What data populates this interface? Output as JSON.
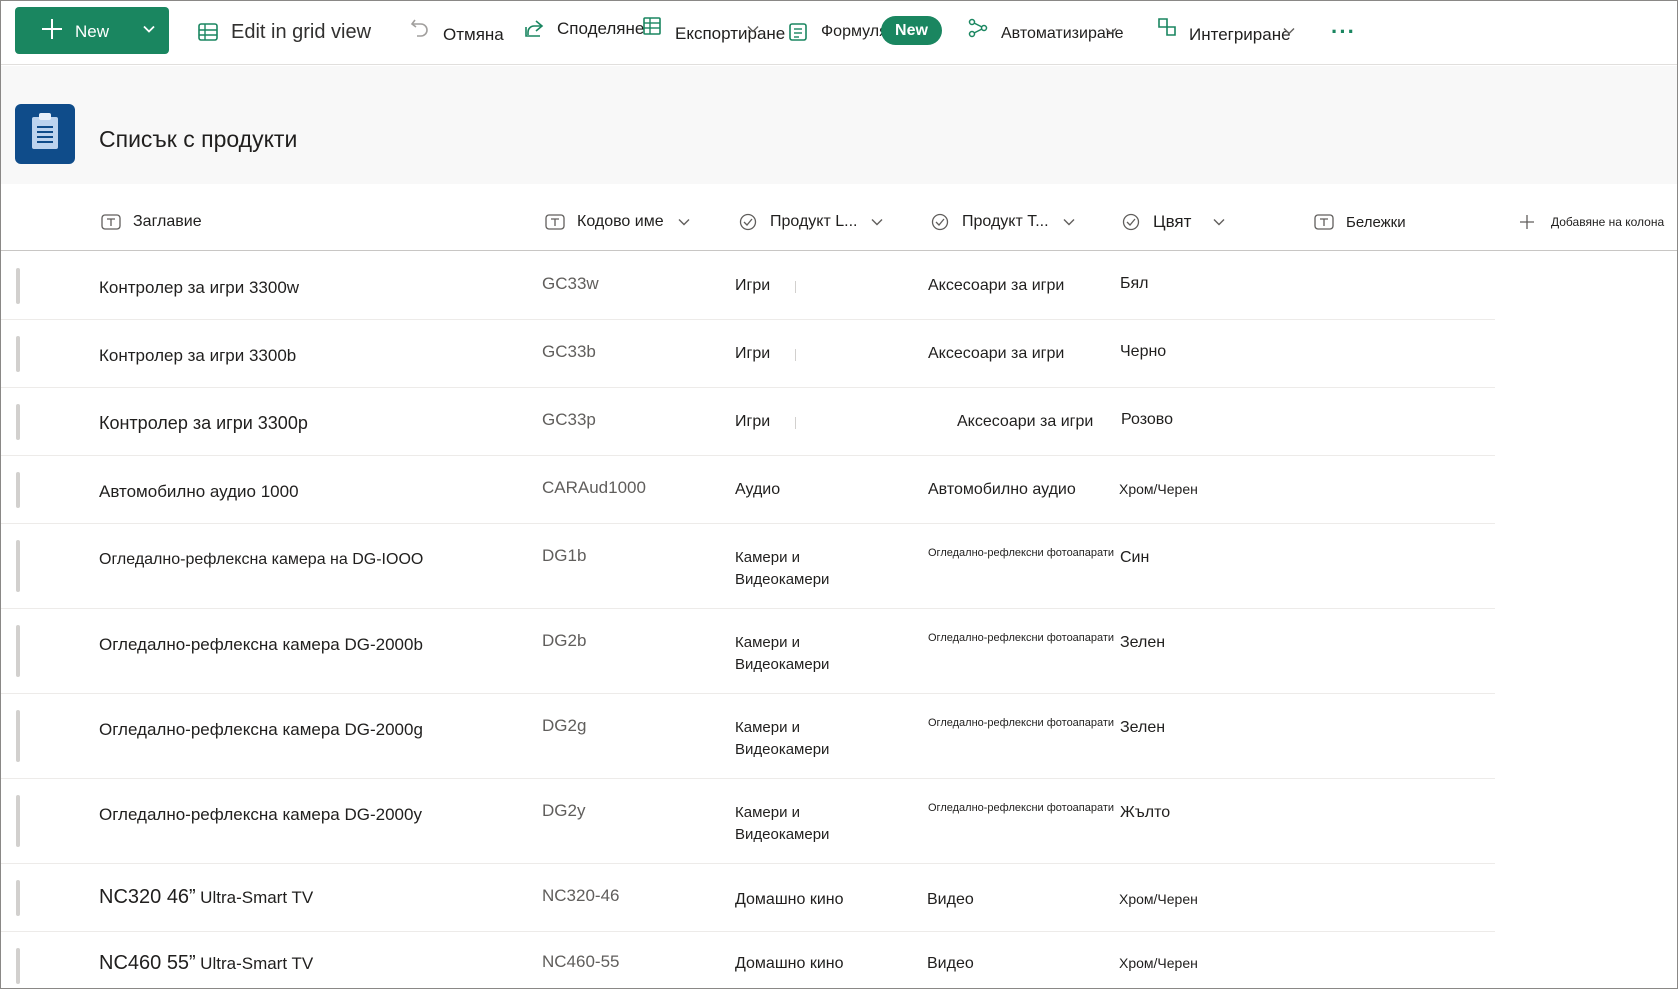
{
  "toolbar": {
    "new_label": "New",
    "grid_view_label": "Edit in grid view",
    "undo_label": "Отмяна",
    "share_label": "Споделяне",
    "export_label": "Експортиране",
    "forms_label": "Формуляри",
    "forms_badge": "New",
    "automate_label": "Автоматизиране",
    "integrate_label": "Интегриране",
    "more_label": "···"
  },
  "list": {
    "title": "Списък с продукти"
  },
  "columns": {
    "title": "Заглавие",
    "code_name": "Кодово име",
    "product_line": "Продукт L...",
    "product_type": "Продукт Т...",
    "color": "Цвят",
    "notes": "Бележки",
    "add_column": "Добавяне на колона"
  },
  "rows": [
    {
      "title": "Контролер за игри 3300w",
      "code": "GC33w",
      "line1": "Игри",
      "line2": "",
      "type": "Аксесоари за игри",
      "color": "Бял"
    },
    {
      "title": "Контролер за игри 3300b",
      "code": "GC33b",
      "line1": "Игри",
      "line2": "",
      "type": "Аксесоари за игри",
      "color": "Черно"
    },
    {
      "title": "Контролер за игри 3300p",
      "code": "GC33p",
      "line1": "Игри",
      "line2": "",
      "type": "Аксесоари за игри",
      "color": "Розово"
    },
    {
      "title": "Автомобилно аудио 1000",
      "code": "CARAud1000",
      "line1": "Аудио",
      "line2": "",
      "type": "Автомобилно аудио",
      "color": "Хром/Черен"
    },
    {
      "title": "Огледално-рефлексна камера на DG-IOOO",
      "code": "DG1b",
      "line1": "Камери и",
      "line2": "Видеокамери",
      "type": "Огледално-рефлексни фотоапарати",
      "color": "Син"
    },
    {
      "title": "Огледално-рефлексна камера DG-2000b",
      "code": "DG2b",
      "line1": "Камери и",
      "line2": "Видеокамери",
      "type": "Огледално-рефлексни фотоапарати",
      "color": "Зелен"
    },
    {
      "title": "Огледално-рефлексна камера DG-2000g",
      "code": "DG2g",
      "line1": "Камери и",
      "line2": "Видеокамери",
      "type": "Огледално-рефлексни фотоапарати",
      "color": "Зелен"
    },
    {
      "title": "Огледално-рефлексна камера DG-2000y",
      "code": "DG2y",
      "line1": "Камери и",
      "line2": "Видеокамери",
      "type": "Огледално-рефлексни фотоапарати",
      "color": "Жълто"
    },
    {
      "title_main": "NC320 46”",
      "title_sub": "Ultra-Smart TV",
      "code": "NC320-46",
      "line1": "Домашно кино",
      "line2": "",
      "type": "Видео",
      "color": "Хром/Черен"
    },
    {
      "title_main": "NC460 55”",
      "title_sub": "Ultra-Smart TV",
      "code": "NC460-55",
      "line1": "Домашно кино",
      "line2": "",
      "type": "Видео",
      "color": "Хром/Черен"
    }
  ],
  "colors": {
    "accent": "#1a8660",
    "list_icon": "#0f4c8a"
  }
}
